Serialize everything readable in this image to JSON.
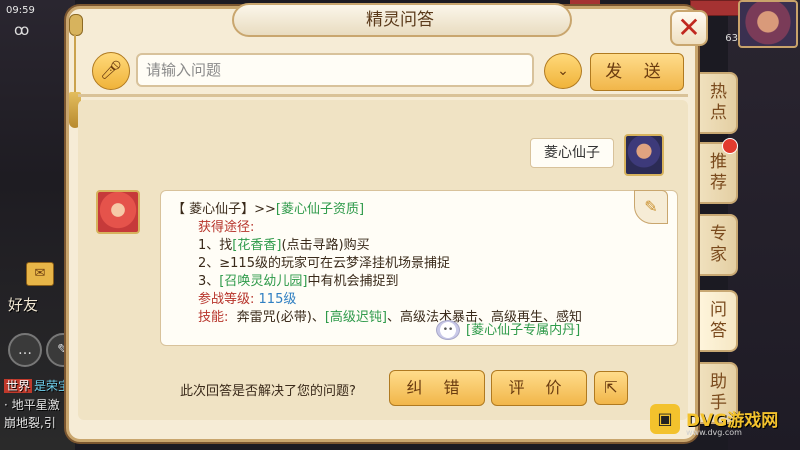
{
  "status": {
    "clock": "09:59",
    "level": "63"
  },
  "window": {
    "title": "精灵问答"
  },
  "input": {
    "placeholder": "请输入问题",
    "value": ""
  },
  "toolbar": {
    "send_label": "发 送",
    "mic_icon": "microphone-icon",
    "dropdown_icon": "chevron-down-icon"
  },
  "side_tabs": [
    {
      "label": "热点"
    },
    {
      "label": "推荐"
    },
    {
      "label": "专家"
    },
    {
      "label": "问答",
      "active": true
    },
    {
      "label": "助手"
    }
  ],
  "messages": {
    "user": {
      "text": "菱心仙子"
    },
    "bot": {
      "header_prefix": "【 菱心仙子】>>",
      "header_link": "[菱心仙子资质]",
      "obtain_label": "获得途径:",
      "way1_prefix": "1、找",
      "way1_link": "[花香香]",
      "way1_suffix": "(点击寻路)购买",
      "way2": "2、≥115级的玩家可在云梦泽挂机场景捕捉",
      "way3_prefix": "3、",
      "way3_link": "[召唤灵幼儿园]",
      "way3_suffix": "中有机会捕捉到",
      "level_label": "参战等级:",
      "level_value": "115级",
      "skills_label": "技能:",
      "skills_a": "奔雷咒(必带)、",
      "skills_link": "[高级迟钝]",
      "skills_b": "、高级法术暴击、高级再生、感知",
      "dan_link": "[菱心仙子专属内丹]"
    }
  },
  "footer": {
    "question": "此次回答是否解决了您的问题?",
    "fix_label": "纠 错",
    "rate_label": "评 价"
  },
  "left_panel": {
    "friends_label": "好友",
    "chat_line1_tag": "世界",
    "chat_line1_name": "是荣宝",
    "chat_line2": "· 地平星激",
    "chat_line3": "崩地裂,引"
  },
  "watermark": {
    "text": "DVG游戏网",
    "url": "www.dvg.com"
  },
  "colors": {
    "accent": "#f1b64a",
    "panel_bg": "#f6ecd6",
    "link_green": "#2e9a4a",
    "label_red": "#b7342b",
    "value_blue": "#2f7fc2"
  }
}
